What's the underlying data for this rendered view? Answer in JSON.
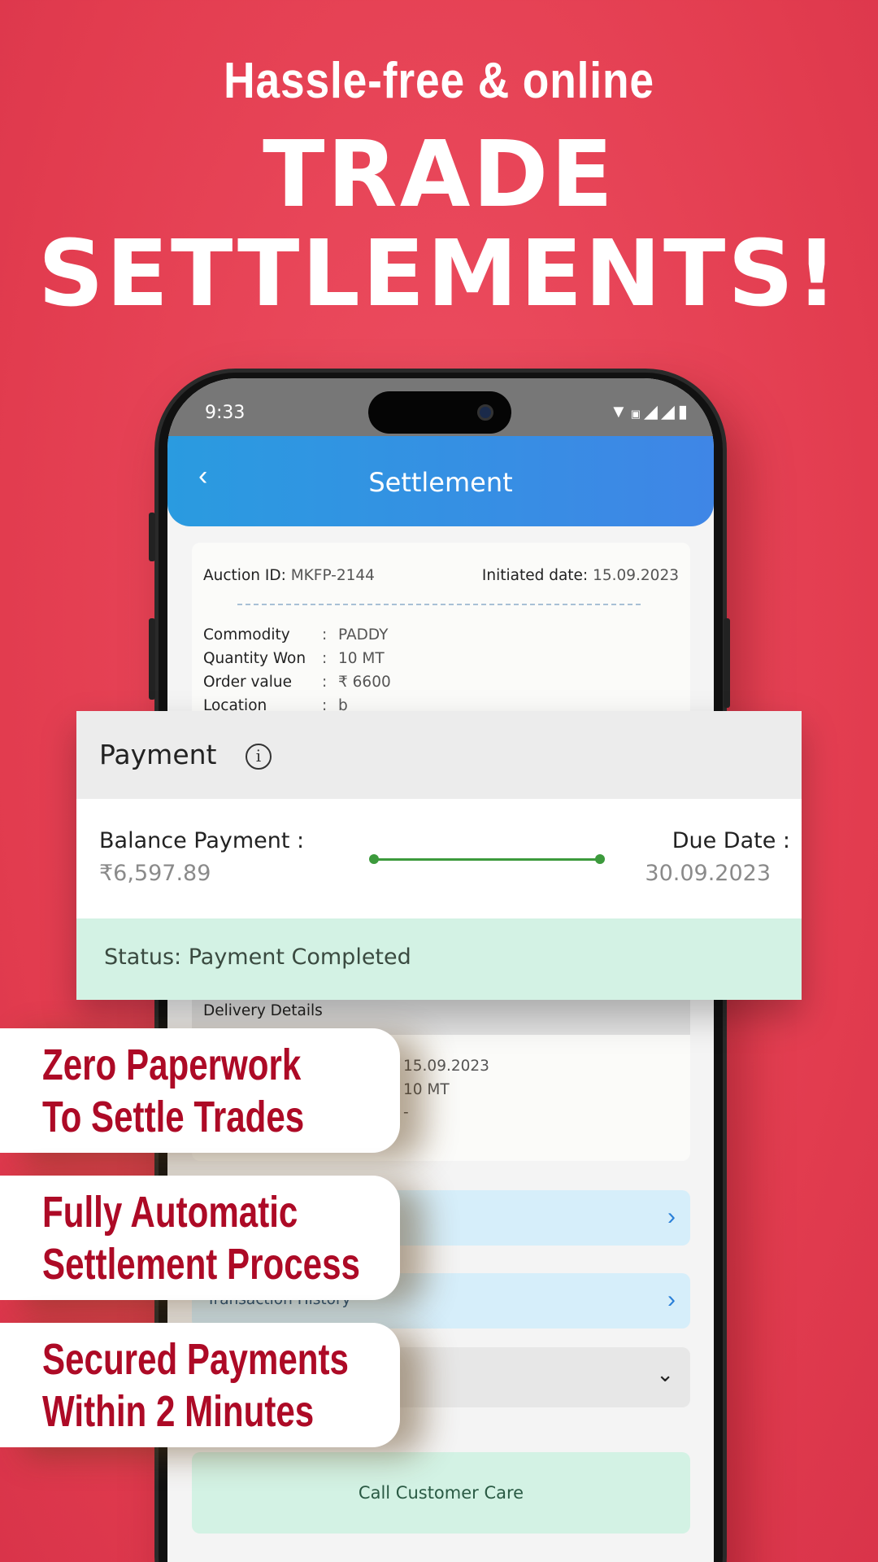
{
  "promo": {
    "tagline": "Hassle-free & online",
    "headline_1": "TRADE",
    "headline_2": "SETTLEMENTS!"
  },
  "status_bar": {
    "time": "9:33",
    "icons": [
      "wifi-icon",
      "volte-icon",
      "signal-icon",
      "signal-icon",
      "battery-icon"
    ]
  },
  "header": {
    "title": "Settlement",
    "back_icon": "chevron-left-icon"
  },
  "auction": {
    "id_label": "Auction ID:",
    "id_value": "MKFP-2144",
    "date_label": "Initiated date:",
    "date_value": "15.09.2023",
    "rows": [
      {
        "label": "Commodity",
        "value": "PADDY"
      },
      {
        "label": "Quantity Won",
        "value": "10 MT"
      },
      {
        "label": "Order value",
        "value": "₹ 6600"
      },
      {
        "label": "Location",
        "value": "b"
      }
    ]
  },
  "payment": {
    "title": "Payment",
    "balance_label": "Balance Payment :",
    "balance_value": "₹6,597.89",
    "due_label": "Due Date :",
    "due_value": "30.09.2023",
    "status": "Status: Payment Completed"
  },
  "delivery": {
    "title": "Delivery Details",
    "values": [
      "15.09.2023",
      "10 MT",
      "-"
    ]
  },
  "sections": {
    "transaction_history": "Transaction History"
  },
  "care_button": "Call Customer Care",
  "features": [
    {
      "line1": "Zero Paperwork",
      "line2": "To Settle Trades"
    },
    {
      "line1": "Fully Automatic",
      "line2": "Settlement Process"
    },
    {
      "line1": "Secured Payments",
      "line2": "Within 2 Minutes"
    }
  ],
  "colors": {
    "background": "#e23c4f",
    "header": "#3a8fe4",
    "feature_text": "#ad0a26",
    "status_green": "#d3f2e4",
    "progress": "#3c9a3c"
  }
}
